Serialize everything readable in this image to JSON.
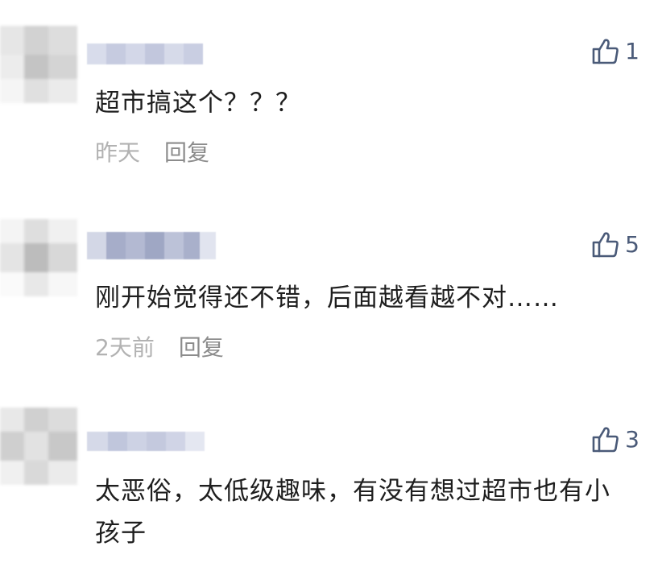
{
  "comments": [
    {
      "text": "超市搞这个？？？",
      "time": "昨天",
      "reply_label": "回复",
      "likes": "1"
    },
    {
      "text": "刚开始觉得还不错，后面越看越不对……",
      "time": "2天前",
      "reply_label": "回复",
      "likes": "5"
    },
    {
      "text": "太恶俗，太低级趣味，有没有想过超市也有小孩子",
      "likes": "3"
    }
  ],
  "colors": {
    "like_icon": "#4a5a78",
    "text": "#1e1e1e",
    "time": "#b2b2b2",
    "reply": "#8c8c8c"
  },
  "icons": {
    "like": "thumbs-up-icon"
  }
}
